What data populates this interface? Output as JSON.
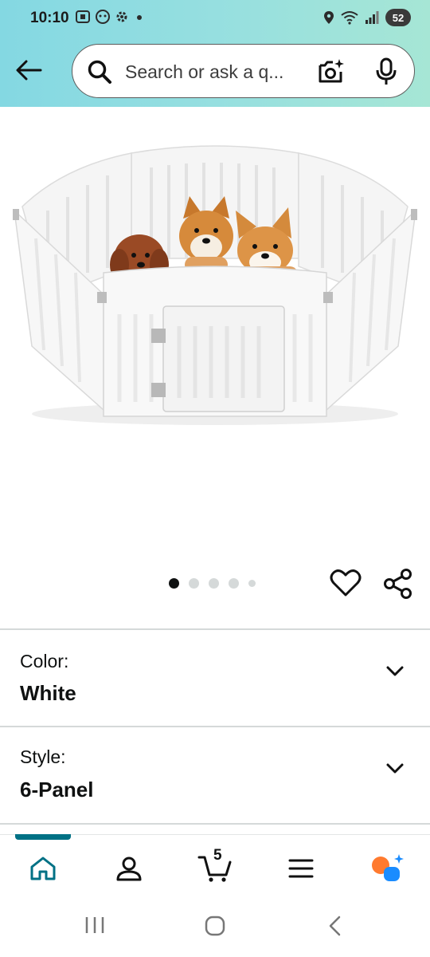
{
  "status_bar": {
    "time": "10:10",
    "battery": "52"
  },
  "search": {
    "placeholder": "Search or ask a q..."
  },
  "carousel": {
    "total_images": 5,
    "active_index": 0
  },
  "options": [
    {
      "label": "Color:",
      "value": "White"
    },
    {
      "label": "Style:",
      "value": "6-Panel"
    }
  ],
  "bottom_nav": {
    "items": [
      "home",
      "account",
      "cart",
      "menu",
      "rufus"
    ],
    "active": "home",
    "cart_count": "5"
  },
  "colors": {
    "header_gradient_start": "#84d8e2",
    "header_gradient_end": "#a6e6d5",
    "accent": "#007185",
    "text": "#0f1111",
    "rufus_orange": "#ff7a2f",
    "rufus_blue": "#1a8cff"
  }
}
